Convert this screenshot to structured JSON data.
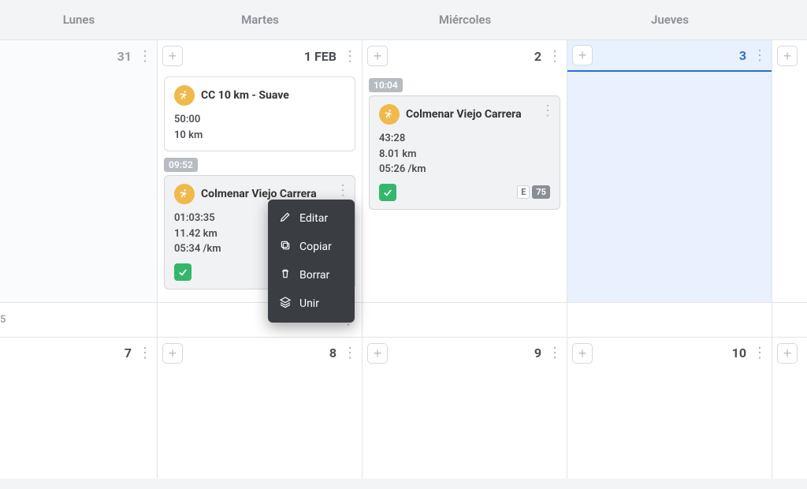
{
  "headers": {
    "mon": "Lunes",
    "tue": "Martes",
    "wed": "Miércoles",
    "thu": "Jueves"
  },
  "week1": {
    "mon": {
      "num": "31"
    },
    "tue": {
      "num": "1 FEB",
      "card1": {
        "title": "CC 10 km - Suave",
        "stat1": "50:00",
        "stat2": "10 km"
      },
      "time_chip": "09:52",
      "card2": {
        "title": "Colmenar Viejo Carrera",
        "stat1": "01:03:35",
        "stat2": "11.42 km",
        "stat3": "05:34 /km"
      }
    },
    "wed": {
      "num": "2",
      "time_chip": "10:04",
      "card": {
        "title": "Colmenar Viejo Carrera",
        "stat1": "43:28",
        "stat2": "8.01 km",
        "stat3": "05:26 /km",
        "e_label": "E",
        "e_num": "75"
      }
    },
    "thu": {
      "num": "3"
    }
  },
  "summary_row": {
    "partial": "5"
  },
  "week2": {
    "mon": {
      "num": "7"
    },
    "tue": {
      "num": "8"
    },
    "wed": {
      "num": "9"
    },
    "thu": {
      "num": "10"
    }
  },
  "context_menu": {
    "edit": "Editar",
    "copy": "Copiar",
    "delete": "Borrar",
    "merge": "Unir"
  }
}
